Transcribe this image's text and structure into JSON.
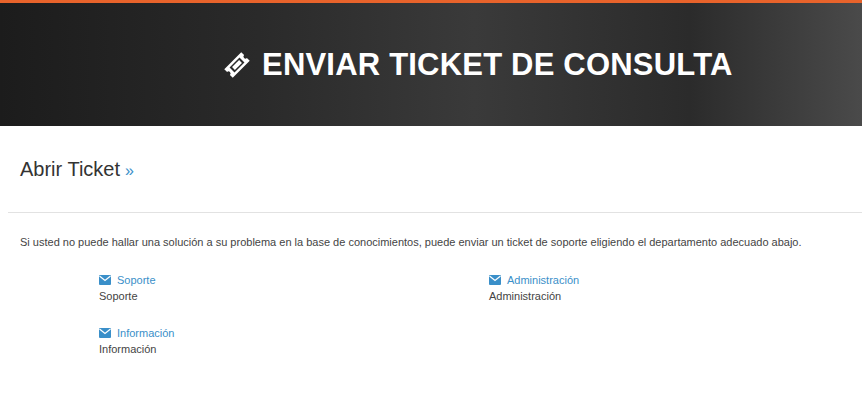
{
  "header": {
    "title": "ENVIAR TICKET DE CONSULTA"
  },
  "section": {
    "title": "Abrir Ticket",
    "arrow": "»"
  },
  "intro": "Si usted no puede hallar una solución a su problema en la base de conocimientos, puede enviar un ticket de soporte eligiendo el departamento adecuado abajo.",
  "departments": [
    {
      "name": "Soporte",
      "description": "Soporte"
    },
    {
      "name": "Administración",
      "description": "Administración"
    },
    {
      "name": "Información",
      "description": "Información"
    }
  ]
}
